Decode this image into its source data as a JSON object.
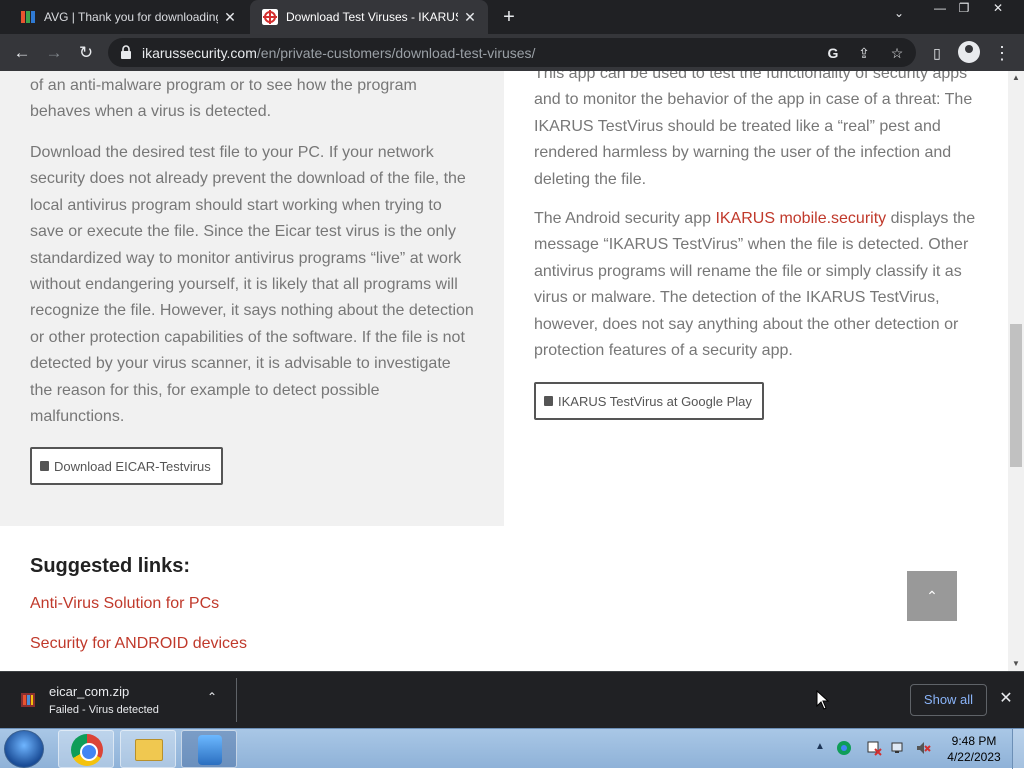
{
  "tabs": [
    {
      "title": "AVG | Thank you for downloading",
      "close": "✕"
    },
    {
      "title": "Download Test Viruses - IKARUS",
      "close": "✕"
    }
  ],
  "new_tab": "+",
  "tab_search": "⌄",
  "window_controls": {
    "minimize": "—",
    "restore": "❐",
    "close": "✕"
  },
  "nav": {
    "back": "←",
    "forward": "→",
    "reload": "↻"
  },
  "address": {
    "host": "ikarussecurity.com",
    "path": "/en/private-customers/download-test-viruses/"
  },
  "toolbar_icons": {
    "google": "G",
    "share": "⇪",
    "bookmark": "☆",
    "sidepanel": "▯",
    "menu": "⋮"
  },
  "page": {
    "left_intro": "of an anti-malware program or to see how the program behaves when a virus is detected.",
    "left_body": "Download the desired test file to your PC. If your network security does not already prevent the download of the file, the local antivirus program should start working when trying to save or execute the file. Since the Eicar test virus is the only standardized way to monitor antivirus programs “live” at work without endangering yourself, it is likely that all programs will recognize the file. However, it says nothing about the detection or other protection capabilities of the software. If the file is not detected by your virus scanner, it is advisable to investigate the reason for this, for example to detect possible malfunctions.",
    "eicar_button": "Download EICAR-Testvirus",
    "right_intro": "This app can be used to test the functionality of security apps and to monitor the behavior of the app in case of a threat: The IKARUS TestVirus should be treated like a “real” pest and rendered harmless by warning the user of the infection and deleting the file.",
    "right_body_pre": "The Android security app ",
    "right_body_link": "IKARUS mobile.security",
    "right_body_post": " displays the message “IKARUS TestVirus” when the file is detected. Other antivirus programs will rename the file or simply classify it as virus or malware. The detection of the IKARUS TestVirus, however, does not say anything about the other detection or protection features of a security app.",
    "play_button": "IKARUS TestVirus at Google Play",
    "suggested_heading": "Suggested links:",
    "suggested_links": [
      "Anti-Virus Solution for PCs",
      "Security for ANDROID devices"
    ],
    "to_top": "⌃"
  },
  "download_bar": {
    "filename": "eicar_com.zip",
    "status": "Failed - Virus detected",
    "show_all": "Show all",
    "chevron": "⌃",
    "close": "✕"
  },
  "taskbar": {
    "clock_time": "9:48 PM",
    "clock_date": "4/22/2023",
    "tray_arrow": "▲"
  },
  "colors": {
    "link": "#c0392b",
    "chrome_dark": "#202124",
    "chrome_toolbar": "#35363a",
    "show_all_text": "#8ab4f8"
  }
}
